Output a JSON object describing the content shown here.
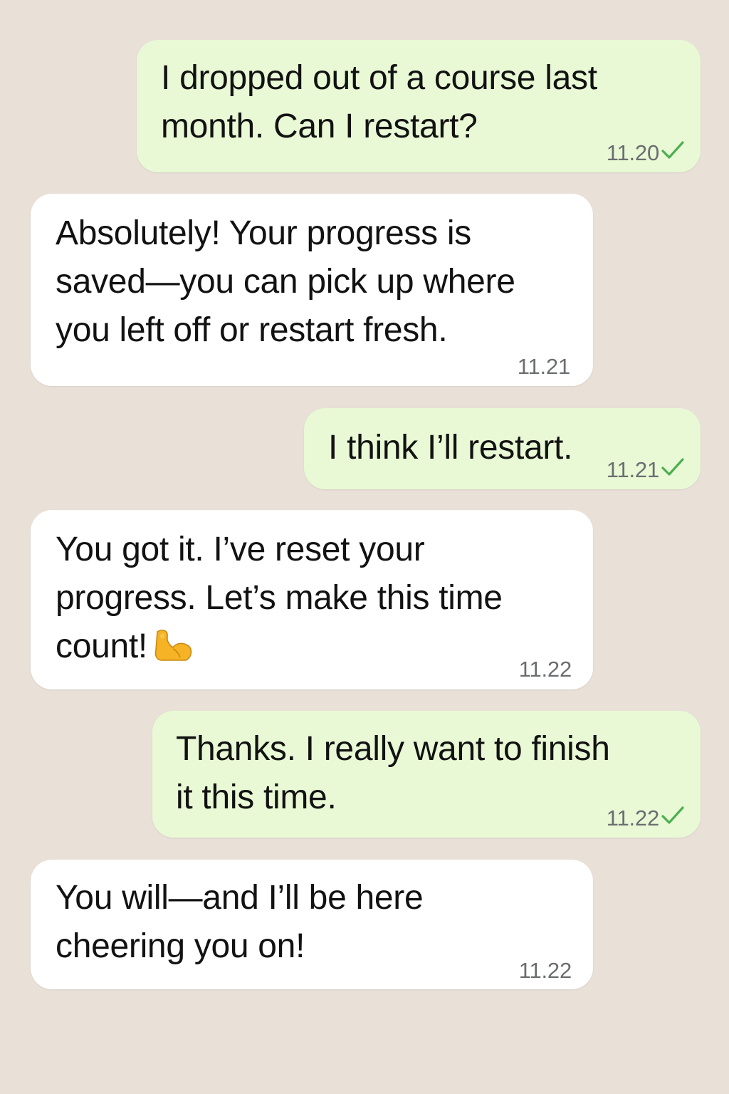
{
  "chat": {
    "messages": [
      {
        "direction": "outgoing",
        "text": "I dropped out of a course last\nmonth. Can I restart?",
        "time": "11.20",
        "status": "sent-check-icon"
      },
      {
        "direction": "incoming",
        "text": "Absolutely! Your progress is\nsaved—you can pick up where\nyou left off or restart fresh.",
        "time": "11.21"
      },
      {
        "direction": "outgoing",
        "text": "I think I’ll restart.",
        "time": "11.21",
        "status": "sent-check-icon"
      },
      {
        "direction": "incoming",
        "text": "You got it. I’ve reset your\nprogress. Let’s make this time\ncount!",
        "emoji": "flexed-biceps-icon",
        "time": "11.22"
      },
      {
        "direction": "outgoing",
        "text": "Thanks. I really want to finish\nit this time.",
        "time": "11.22",
        "status": "sent-check-icon"
      },
      {
        "direction": "incoming",
        "text": "You will—and I’ll be here\ncheering you on!",
        "time": "11.22"
      }
    ]
  },
  "colors": {
    "background": "#e9e1d8",
    "outgoing_bubble": "#e9f9d6",
    "incoming_bubble": "#ffffff",
    "check": "#4caf50",
    "timestamp": "#6b6e70"
  }
}
